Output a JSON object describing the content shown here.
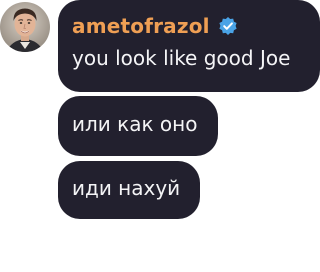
{
  "author": {
    "name": "ametofrazol",
    "verified": true,
    "avatar": "profile-photo-icon"
  },
  "messages": [
    {
      "text": "you look like good Joe"
    },
    {
      "text": "или как оно"
    },
    {
      "text": "иди нахуй"
    }
  ],
  "colors": {
    "bubble": "#22202e",
    "username": "#ef9f54",
    "verified_badge": "#4aa3e6",
    "text": "#f4f4f6"
  }
}
